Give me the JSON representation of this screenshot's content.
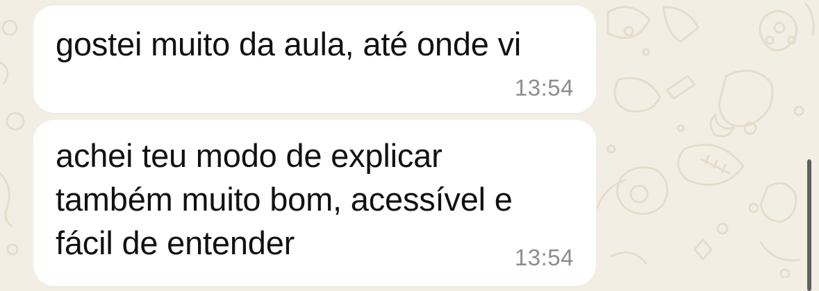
{
  "chat": {
    "messages": [
      {
        "lines": [
          "gostei muito da aula, até onde vi"
        ],
        "time": "13:54"
      },
      {
        "lines": [
          "achei teu modo de explicar",
          "também muito bom, acessível e",
          "fácil de entender"
        ],
        "time": "13:54"
      }
    ]
  },
  "colors": {
    "background": "#f3eee4",
    "bubble": "#ffffff",
    "text": "#111111",
    "timestamp": "#8d8d8d",
    "scrollbar": "#606060"
  },
  "icons": {
    "wallpaper": "chat-doodle-pattern"
  }
}
